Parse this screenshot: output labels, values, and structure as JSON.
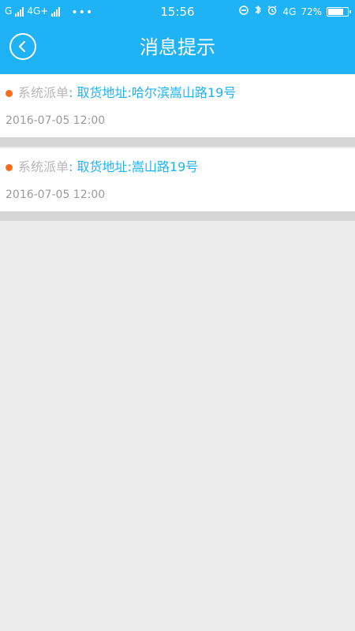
{
  "status_bar": {
    "carrier_text": "G",
    "network_text": "4G+",
    "more_text": "•••",
    "time": "15:56",
    "network_right": "4G",
    "battery_percent": "72%",
    "battery_level": 0.72,
    "icons": [
      "signal-icon",
      "signal-icon",
      "more-icon",
      "rotation-lock-icon",
      "bluetooth-icon",
      "alarm-icon",
      "battery-icon"
    ]
  },
  "header": {
    "title": "消息提示",
    "back_icon": "chevron-left-icon",
    "brand_color": "#1fb3f5"
  },
  "messages": [
    {
      "category": "系统派单",
      "address": ": 取货地址:哈尔滨嵩山路19号",
      "timestamp": "2016-07-05 12:00",
      "status_color": "#ff6b1a"
    },
    {
      "category": "系统派单",
      "address": ": 取货地址:嵩山路19号",
      "timestamp": "2016-07-05 12:00",
      "status_color": "#ff6b1a"
    }
  ]
}
